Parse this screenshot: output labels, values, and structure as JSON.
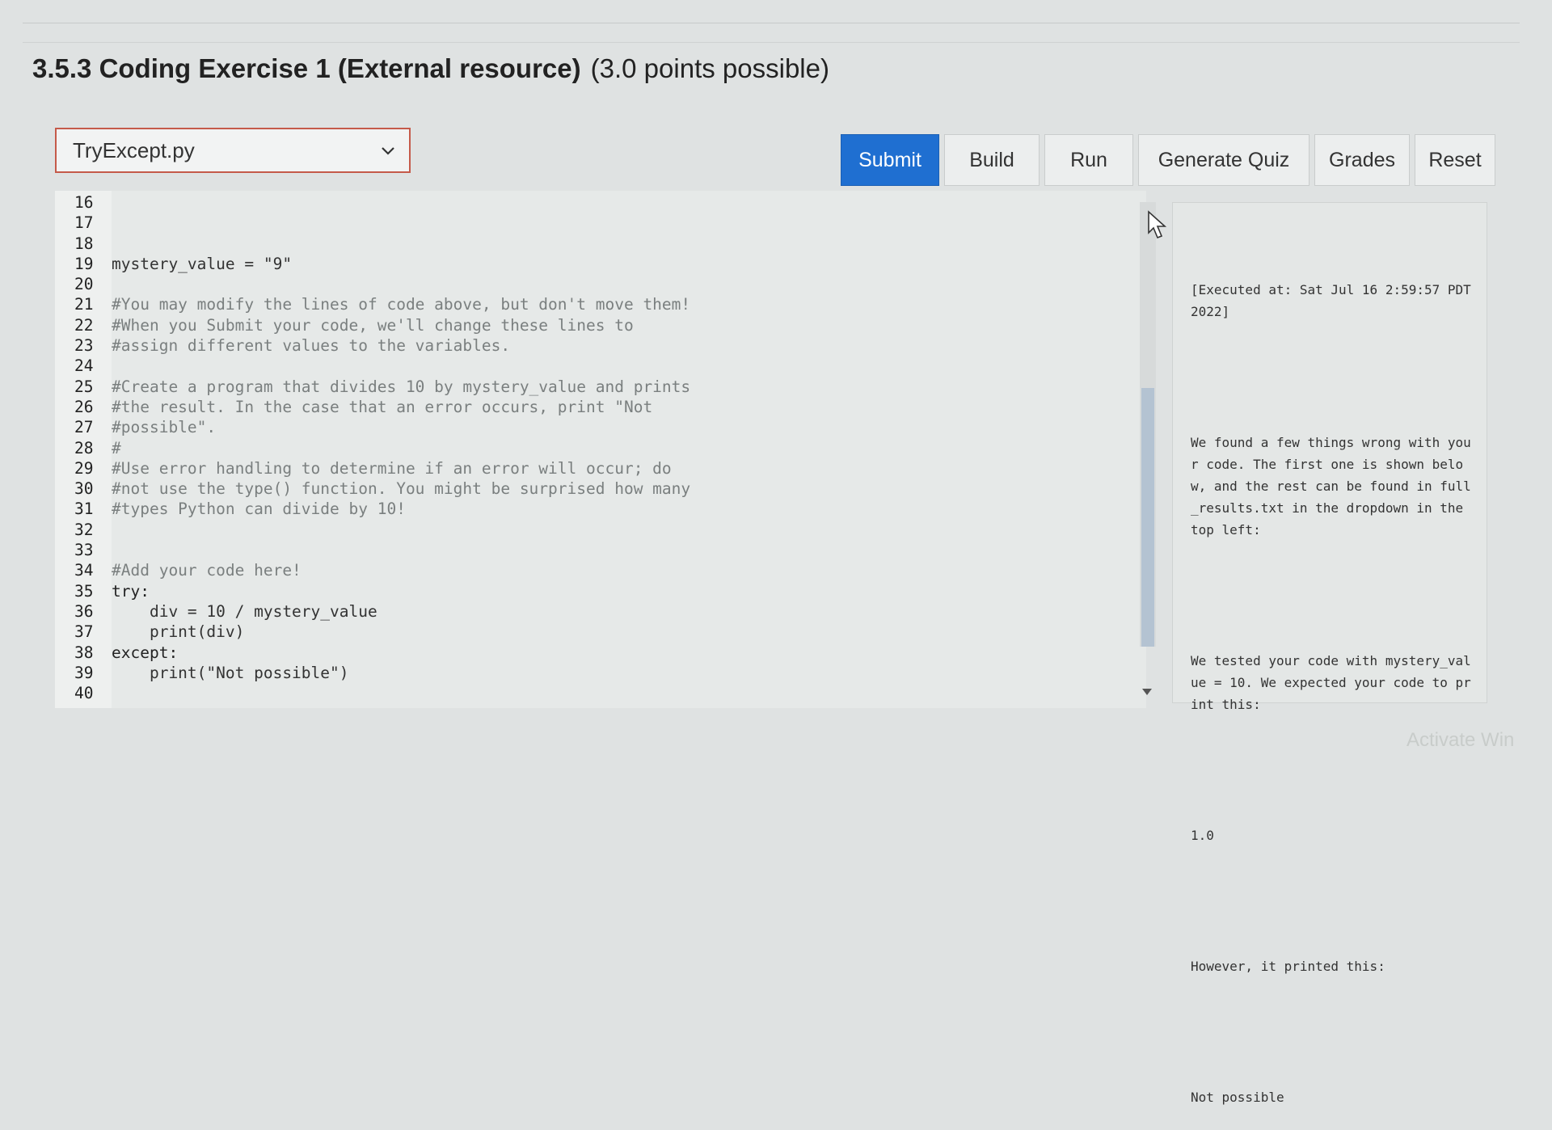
{
  "heading": {
    "title": "3.5.3 Coding Exercise 1 (External resource)",
    "points": "(3.0 points possible)"
  },
  "file_select": {
    "value": "TryExcept.py"
  },
  "toolbar": {
    "submit": "Submit",
    "build": "Build",
    "run": "Run",
    "generate_quiz": "Generate Quiz",
    "grades": "Grades",
    "reset": "Reset"
  },
  "editor": {
    "lines": [
      {
        "n": "16",
        "text": "",
        "type": "code"
      },
      {
        "n": "17",
        "text": "",
        "type": "code"
      },
      {
        "n": "18",
        "text": "",
        "type": "code"
      },
      {
        "n": "19",
        "text": "mystery_value = \"9\"",
        "type": "code"
      },
      {
        "n": "20",
        "text": "",
        "type": "code"
      },
      {
        "n": "21",
        "text": "#You may modify the lines of code above, but don't move them!",
        "type": "comment"
      },
      {
        "n": "22",
        "text": "#When you Submit your code, we'll change these lines to",
        "type": "comment"
      },
      {
        "n": "23",
        "text": "#assign different values to the variables.",
        "type": "comment"
      },
      {
        "n": "24",
        "text": "",
        "type": "code"
      },
      {
        "n": "25",
        "text": "#Create a program that divides 10 by mystery_value and prints",
        "type": "comment"
      },
      {
        "n": "26",
        "text": "#the result. In the case that an error occurs, print \"Not",
        "type": "comment"
      },
      {
        "n": "27",
        "text": "#possible\".",
        "type": "comment"
      },
      {
        "n": "28",
        "text": "#",
        "type": "comment"
      },
      {
        "n": "29",
        "text": "#Use error handling to determine if an error will occur; do",
        "type": "comment"
      },
      {
        "n": "30",
        "text": "#not use the type() function. You might be surprised how many",
        "type": "comment"
      },
      {
        "n": "31",
        "text": "#types Python can divide by 10!",
        "type": "comment"
      },
      {
        "n": "32",
        "text": "",
        "type": "code"
      },
      {
        "n": "33",
        "text": "",
        "type": "code"
      },
      {
        "n": "34",
        "text": "#Add your code here!",
        "type": "comment"
      },
      {
        "n": "35",
        "text": "try:",
        "type": "kw"
      },
      {
        "n": "36",
        "text": "    div = 10 / mystery_value",
        "type": "code"
      },
      {
        "n": "37",
        "text": "    print(div)",
        "type": "code"
      },
      {
        "n": "38",
        "text": "except:",
        "type": "kw"
      },
      {
        "n": "39",
        "text": "    print(\"Not possible\")",
        "type": "code"
      },
      {
        "n": "40",
        "text": "",
        "type": "code"
      }
    ]
  },
  "output": {
    "executed": "[Executed at: Sat Jul 16 2:59:57 PDT 2022]",
    "message": "We found a few things wrong with your code. The first one is shown below, and the rest can be found in full_results.txt in the dropdown in the top left:",
    "tested": "We tested your code with mystery_value = 10. We expected your code to print this:",
    "expected": "1.0",
    "however": "However, it printed this:",
    "actual": "Not possible"
  },
  "watermark": "Activate Win"
}
